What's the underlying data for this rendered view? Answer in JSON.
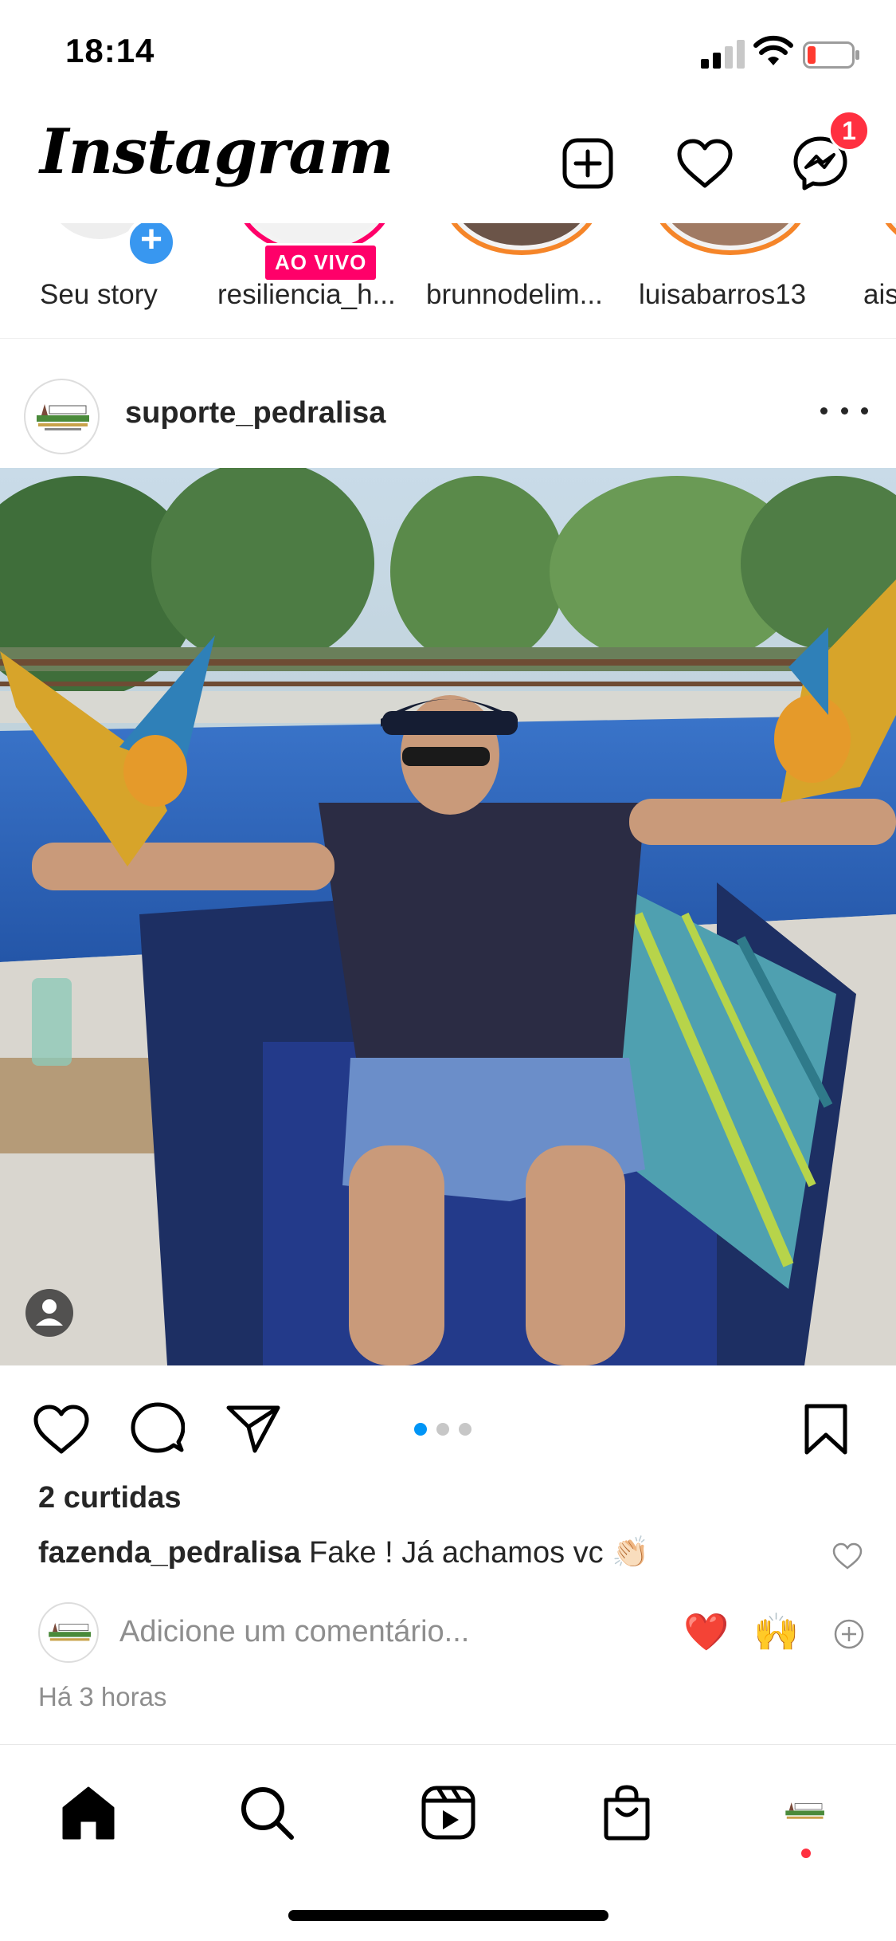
{
  "status_bar": {
    "time": "18:14"
  },
  "header": {
    "app_name": "Instagram",
    "messages_badge": "1"
  },
  "stories": {
    "own": {
      "label": "Seu story"
    },
    "live_badge": "AO VIVO",
    "items": [
      {
        "label": "resiliencia_h..."
      },
      {
        "label": "brunnodelim..."
      },
      {
        "label": "luisabarros13"
      },
      {
        "label": "ais"
      }
    ]
  },
  "post": {
    "username": "suporte_pedralisa",
    "likes": "2 curtidas",
    "caption": {
      "user": "fazenda_pedralisa",
      "text": "Fake ! Já achamos vc",
      "emoji": "👏🏻"
    },
    "comment_placeholder": "Adicione um comentário...",
    "quick_reactions": [
      "❤️",
      "🙌"
    ],
    "time_ago": "Há 3 horas",
    "carousel": {
      "count": 3,
      "active": 1
    }
  },
  "colors": {
    "accent": "#0095f6",
    "badge": "#ff3040",
    "live": "#ff0069"
  },
  "icons": {
    "header": [
      "new-post-icon",
      "activity-heart-icon",
      "messenger-icon"
    ],
    "actions": [
      "like-heart-icon",
      "comment-icon",
      "share-icon",
      "save-bookmark-icon"
    ],
    "nav": [
      "home-icon",
      "search-icon",
      "reels-icon",
      "shop-icon",
      "profile-avatar"
    ]
  }
}
